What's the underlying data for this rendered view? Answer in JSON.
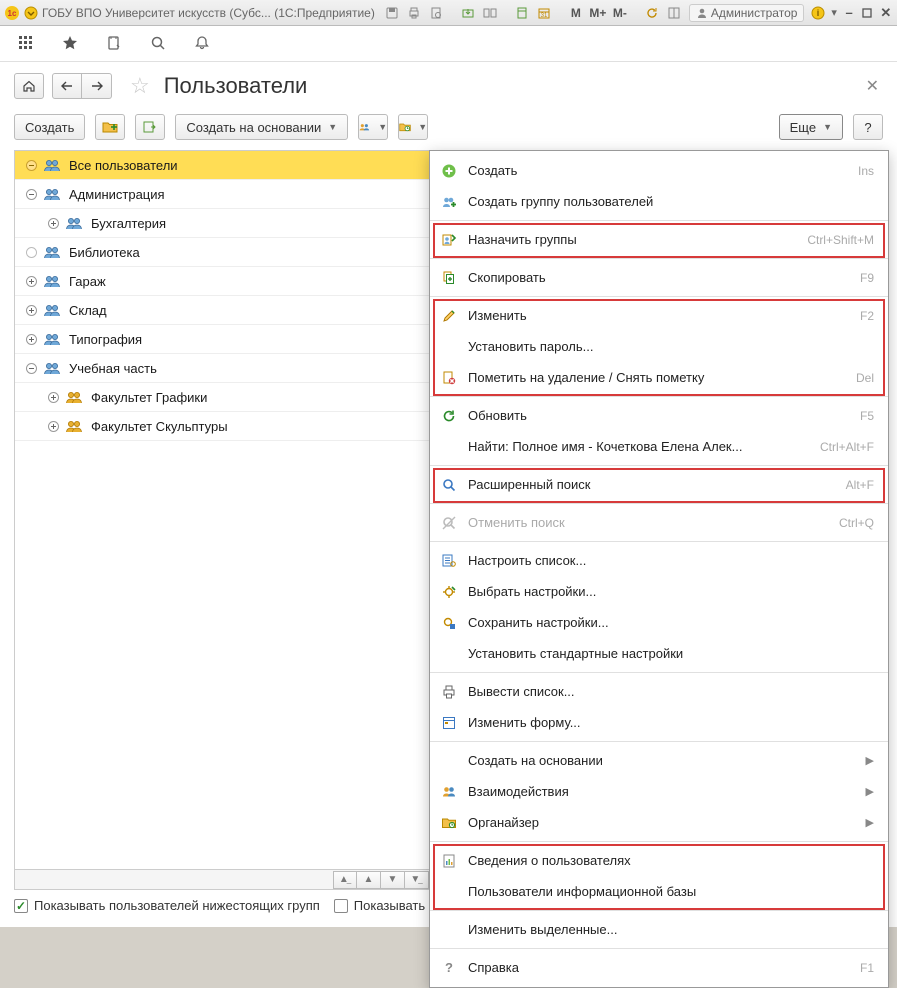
{
  "titlebar": {
    "app_title": "ГОБУ ВПО Университет искусств (Субс...  (1С:Предприятие)",
    "user": "Администратор"
  },
  "page": {
    "title": "Пользователи"
  },
  "toolbar": {
    "create": "Создать",
    "create_based_on": "Создать на основании",
    "more": "Еще"
  },
  "tree": [
    {
      "level": 0,
      "expander": "minus-dot",
      "label": "Все пользователи",
      "selected": true
    },
    {
      "level": 0,
      "expander": "minus",
      "label": "Администрация"
    },
    {
      "level": 1,
      "expander": "plus",
      "label": "Бухгалтерия"
    },
    {
      "level": 0,
      "expander": "dot",
      "label": "Библиотека"
    },
    {
      "level": 0,
      "expander": "plus",
      "label": "Гараж"
    },
    {
      "level": 0,
      "expander": "plus",
      "label": "Склад"
    },
    {
      "level": 0,
      "expander": "plus",
      "label": "Типография"
    },
    {
      "level": 0,
      "expander": "minus",
      "label": "Учебная часть"
    },
    {
      "level": 1,
      "expander": "plus",
      "label": "Факультет Графики",
      "gold": true
    },
    {
      "level": 1,
      "expander": "plus",
      "label": "Факультет Скульптуры",
      "gold": true
    }
  ],
  "footer": {
    "show_subgroups": "Показывать пользователей нижестоящих групп",
    "show_invalid": "Показывать недействительных пользователей"
  },
  "menu": [
    {
      "icon": "plus",
      "label": "Создать",
      "shortcut": "Ins"
    },
    {
      "icon": "group-add",
      "label": "Создать группу пользователей"
    },
    {
      "sep": true
    },
    {
      "icon": "assign",
      "label": "Назначить группы",
      "shortcut": "Ctrl+Shift+M",
      "hl_group": 1
    },
    {
      "sep": true
    },
    {
      "icon": "copy",
      "label": "Скопировать",
      "shortcut": "F9"
    },
    {
      "sep": true
    },
    {
      "icon": "pencil",
      "label": "Изменить",
      "shortcut": "F2",
      "hl_group": 2
    },
    {
      "icon": "",
      "label": "Установить пароль...",
      "hl_group": 2
    },
    {
      "icon": "mark-del",
      "label": "Пометить на удаление / Снять пометку",
      "shortcut": "Del",
      "hl_group": 2
    },
    {
      "sep": true
    },
    {
      "icon": "refresh",
      "label": "Обновить",
      "shortcut": "F5"
    },
    {
      "icon": "",
      "label": "Найти: Полное имя - Кочеткова Елена Алек...",
      "shortcut": "Ctrl+Alt+F"
    },
    {
      "sep": true
    },
    {
      "icon": "search",
      "label": "Расширенный поиск",
      "shortcut": "Alt+F",
      "hl_group": 3
    },
    {
      "sep": true
    },
    {
      "icon": "search-x",
      "label": "Отменить поиск",
      "shortcut": "Ctrl+Q",
      "disabled": true
    },
    {
      "sep": true
    },
    {
      "icon": "list-gear",
      "label": "Настроить список..."
    },
    {
      "icon": "gear-open",
      "label": "Выбрать настройки..."
    },
    {
      "icon": "gear-save",
      "label": "Сохранить настройки..."
    },
    {
      "icon": "",
      "label": "Установить стандартные настройки"
    },
    {
      "sep": true
    },
    {
      "icon": "print",
      "label": "Вывести список..."
    },
    {
      "icon": "form",
      "label": "Изменить форму..."
    },
    {
      "sep": true
    },
    {
      "icon": "",
      "label": "Создать на основании",
      "submenu": true
    },
    {
      "icon": "people",
      "label": "Взаимодействия",
      "submenu": true
    },
    {
      "icon": "organizer",
      "label": "Органайзер",
      "submenu": true
    },
    {
      "sep": true
    },
    {
      "icon": "report",
      "label": "Сведения о пользователях",
      "hl_group": 4
    },
    {
      "icon": "",
      "label": "Пользователи информационной базы",
      "hl_group": 4
    },
    {
      "sep": true
    },
    {
      "icon": "",
      "label": "Изменить выделенные..."
    },
    {
      "sep": true
    },
    {
      "icon": "help",
      "label": "Справка",
      "shortcut": "F1"
    }
  ]
}
